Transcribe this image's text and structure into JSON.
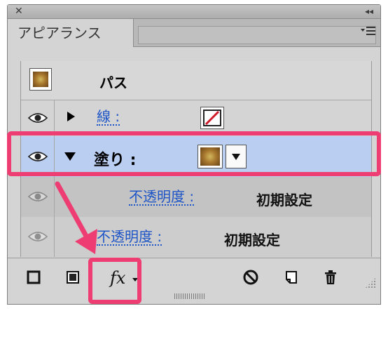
{
  "window": {
    "close_glyph": "✕",
    "collapse_glyph": "◂◂"
  },
  "tab": {
    "label": "アピアランス"
  },
  "panel_menu_icon": "menu-lines-icon",
  "rows": {
    "path": {
      "label": "パス"
    },
    "stroke": {
      "label": "線 :"
    },
    "fill": {
      "label": "塗り :"
    },
    "fill_opacity": {
      "label": "不透明度 :",
      "value": "初期設定"
    },
    "opacity": {
      "label": "不透明度 :",
      "value": "初期設定"
    }
  },
  "toolbar": {
    "fx_label": "fx"
  },
  "colors": {
    "highlight": "#ee3d72",
    "link": "#1f56c7",
    "selected_row": "#b9cef0"
  }
}
